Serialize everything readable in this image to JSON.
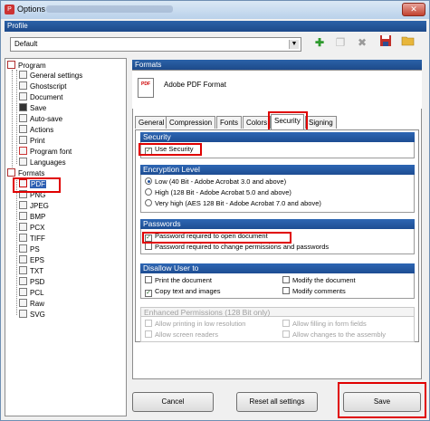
{
  "window": {
    "title": "Options"
  },
  "profile": {
    "section_label": "Profile",
    "selected": "Default"
  },
  "toolbar": {
    "buttons": [
      "add-profile-icon",
      "copy-profile-icon",
      "delete-profile-icon",
      "save-profile-icon",
      "open-folder-icon"
    ]
  },
  "tree": {
    "program": {
      "label": "Program",
      "children": [
        "General settings",
        "Ghostscript",
        "Document",
        "Save",
        "Auto-save",
        "Actions",
        "Print",
        "Program font",
        "Languages"
      ]
    },
    "formats": {
      "label": "Formats",
      "children": [
        "PDF",
        "PNG",
        "JPEG",
        "BMP",
        "PCX",
        "TIFF",
        "PS",
        "EPS",
        "TXT",
        "PSD",
        "PCL",
        "Raw",
        "SVG"
      ]
    }
  },
  "formats_panel": {
    "section_label": "Formats",
    "title": "Adobe PDF Format",
    "icon_text": "PDF"
  },
  "tabs": [
    "General",
    "Compression",
    "Fonts",
    "Colors",
    "Security",
    "Signing"
  ],
  "security": {
    "group_label": "Security",
    "use_security": {
      "label": "Use Security",
      "checked": true
    },
    "encryption": {
      "group_label": "Encryption Level",
      "options": [
        {
          "label": "Low (40 Bit - Adobe Acrobat 3.0 and above)",
          "selected": true
        },
        {
          "label": "High (128 Bit - Adobe Acrobat 5.0 and above)",
          "selected": false
        },
        {
          "label": "Very high (AES 128 Bit - Adobe Acrobat 7.0 and above)",
          "selected": false
        }
      ]
    },
    "passwords": {
      "group_label": "Passwords",
      "open_doc": {
        "label": "Password required to open document",
        "checked": true
      },
      "change_perm": {
        "label": "Password required to change permissions and passwords",
        "checked": false
      }
    },
    "disallow": {
      "group_label": "Disallow User to",
      "print": {
        "label": "Print the document",
        "checked": false
      },
      "modify": {
        "label": "Modify the document",
        "checked": false
      },
      "copy": {
        "label": "Copy text and images",
        "checked": true
      },
      "comments": {
        "label": "Modify comments",
        "checked": false
      }
    },
    "enhanced": {
      "group_label": "Enhanced Permissions (128 Bit only)",
      "low_res": {
        "label": "Allow printing in low resolution",
        "checked": false
      },
      "fill_forms": {
        "label": "Allow filling in form fields",
        "checked": false
      },
      "screen_readers": {
        "label": "Allow screen readers",
        "checked": false
      },
      "assembly": {
        "label": "Allow changes to the assembly",
        "checked": false
      }
    }
  },
  "footer": {
    "cancel": "Cancel",
    "reset": "Reset all settings",
    "save": "Save"
  },
  "colors": {
    "section_bar": "#1d4a8a",
    "highlight": "#e00000",
    "selection": "#2d5fb2"
  }
}
